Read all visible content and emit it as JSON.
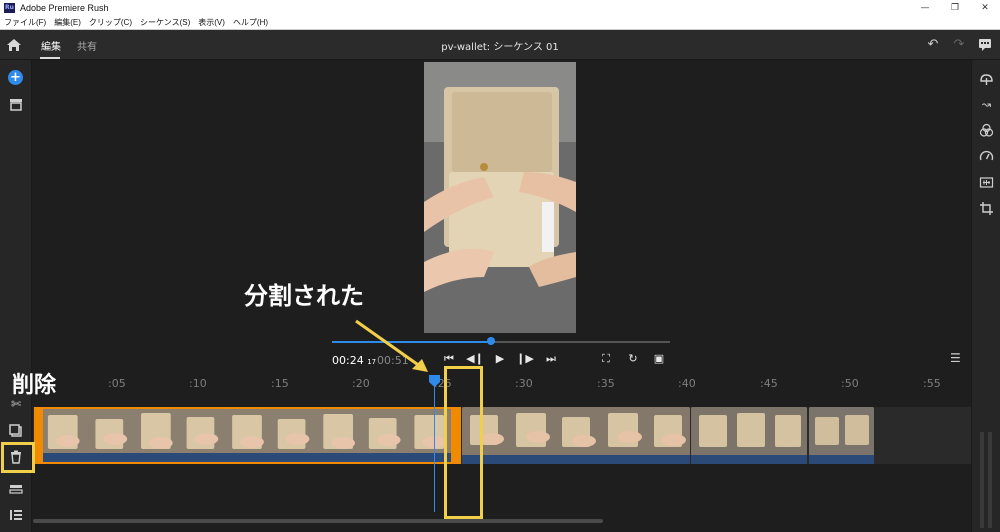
{
  "window": {
    "title": "Adobe Premiere Rush",
    "logo_text": "Ru"
  },
  "menu": [
    "ファイル(F)",
    "編集(E)",
    "クリップ(C)",
    "シーケンス(S)",
    "表示(V)",
    "ヘルプ(H)"
  ],
  "header": {
    "tabs": [
      {
        "label": "編集",
        "active": true
      },
      {
        "label": "共有",
        "active": false
      }
    ],
    "sequence_title": "pv-wallet: シーケンス 01"
  },
  "playback": {
    "current_time": "00:24",
    "current_frames": "17",
    "duration": "00:51",
    "progress": 0.47
  },
  "timeline": {
    "ticks": [
      ":05",
      ":10",
      ":15",
      ":20",
      ":25",
      ":30",
      ":35",
      ":40",
      ":45",
      ":50",
      ":55"
    ]
  },
  "annotations": {
    "split_label": "分割された",
    "delete_label": "削除"
  },
  "colors": {
    "accent": "#2f8bea",
    "selection": "#f08a00",
    "highlight": "#f2cf4a"
  }
}
